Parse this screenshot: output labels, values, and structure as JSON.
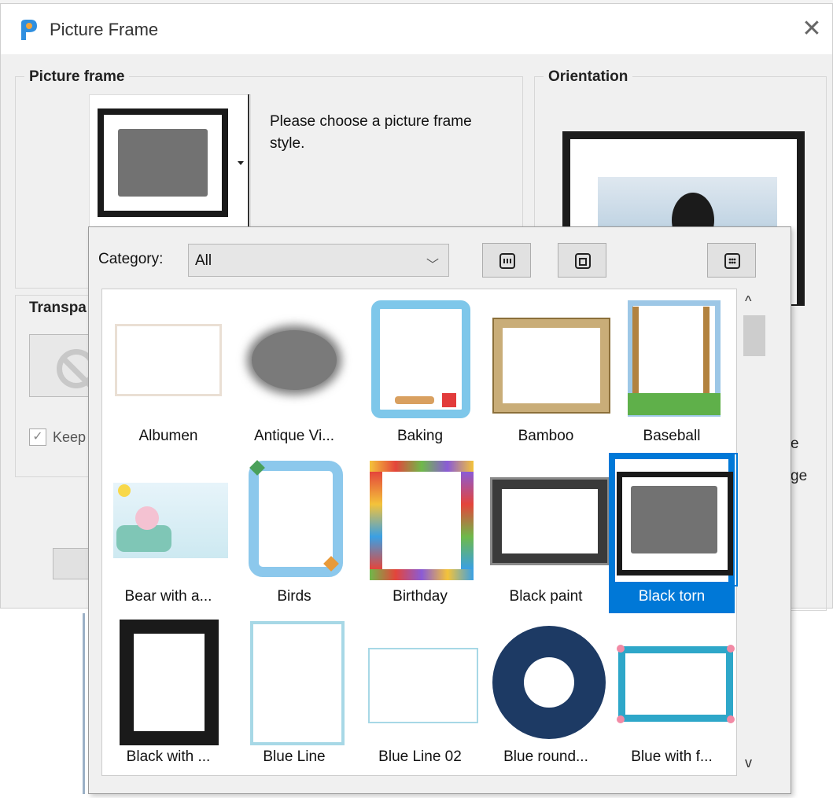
{
  "window": {
    "title": "Picture Frame",
    "close_glyph": "✕"
  },
  "picture_frame": {
    "group_label": "Picture frame",
    "hint": "Please choose a picture frame style.",
    "selected_style": "Black torn"
  },
  "orientation": {
    "group_label": "Orientation"
  },
  "transparency": {
    "group_label": "Transpa",
    "keep_label": "Keep"
  },
  "right_edge_text": {
    "line1": "e",
    "line2": "ge"
  },
  "popup": {
    "category_label": "Category:",
    "category_value": "All",
    "view_buttons": [
      "view-button-1",
      "view-button-2",
      "view-button-3"
    ],
    "scroll_up": "^",
    "scroll_down": "v"
  },
  "frames": [
    {
      "label": "Albumen",
      "icon": "albumen-frame"
    },
    {
      "label": "Antique Vi...",
      "icon": "antique-vignette-frame"
    },
    {
      "label": "Baking",
      "icon": "baking-frame"
    },
    {
      "label": "Bamboo",
      "icon": "bamboo-frame"
    },
    {
      "label": "Baseball",
      "icon": "baseball-frame"
    },
    {
      "label": "Bear with a...",
      "icon": "bear-frame"
    },
    {
      "label": "Birds",
      "icon": "birds-frame"
    },
    {
      "label": "Birthday",
      "icon": "birthday-frame"
    },
    {
      "label": "Black paint",
      "icon": "black-paint-frame"
    },
    {
      "label": "Black torn",
      "icon": "black-torn-frame",
      "selected": true
    },
    {
      "label": "Black with ...",
      "icon": "black-with-frame"
    },
    {
      "label": "Blue Line",
      "icon": "blue-line-frame"
    },
    {
      "label": "Blue Line 02",
      "icon": "blue-line-02-frame"
    },
    {
      "label": "Blue round...",
      "icon": "blue-round-frame"
    },
    {
      "label": "Blue with f...",
      "icon": "blue-with-frame"
    }
  ],
  "colors": {
    "selection": "#0078d7",
    "dialog_bg": "#f0f0f0"
  }
}
